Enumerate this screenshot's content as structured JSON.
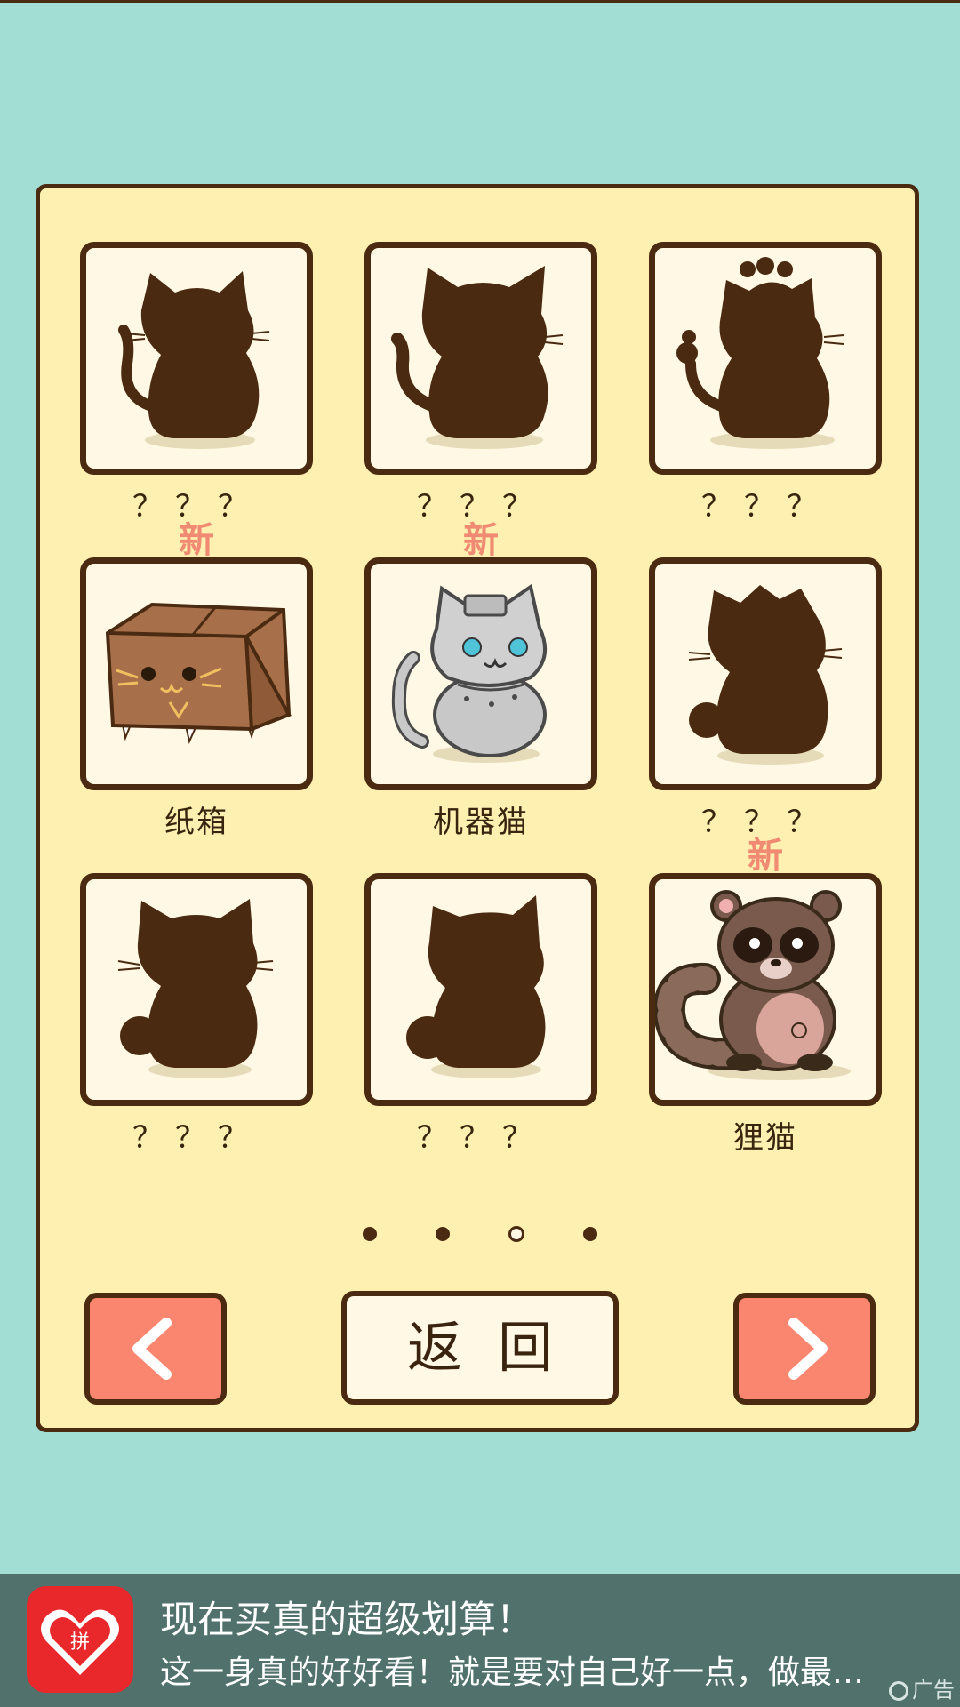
{
  "colors": {
    "background": "#a3ded5",
    "panel": "#fdf0b0",
    "border": "#4a2a10",
    "card": "#fff8e4",
    "new_tag": "#f08a72",
    "nav_button": "#fb8670",
    "ad_bar": "#51726c"
  },
  "collection": {
    "cards": [
      {
        "label": "？？？",
        "new": "",
        "image": "silhouette-cat-icon"
      },
      {
        "label": "？？？",
        "new": "",
        "image": "silhouette-cat-icon"
      },
      {
        "label": "？？？",
        "new": "",
        "image": "silhouette-gourd-cat-icon"
      },
      {
        "label": "纸箱",
        "new": "新",
        "image": "cardboard-box-cat-icon"
      },
      {
        "label": "机器猫",
        "new": "新",
        "image": "robot-cat-icon"
      },
      {
        "label": "？？？",
        "new": "",
        "image": "silhouette-cat-icon"
      },
      {
        "label": "？？？",
        "new": "",
        "image": "silhouette-cat-icon"
      },
      {
        "label": "？？？",
        "new": "",
        "image": "silhouette-cat-icon"
      },
      {
        "label": "狸猫",
        "new": "新",
        "image": "raccoon-dog-icon"
      }
    ]
  },
  "pagination": {
    "total": 4,
    "current": 3
  },
  "buttons": {
    "prev_icon": "chevron-left-icon",
    "back_label": "返回",
    "next_icon": "chevron-right-icon"
  },
  "ad": {
    "title": "现在买真的超级划算！",
    "subtitle": "这一身真的好好看！就是要对自己好一点，做最…",
    "tag": "广告"
  }
}
